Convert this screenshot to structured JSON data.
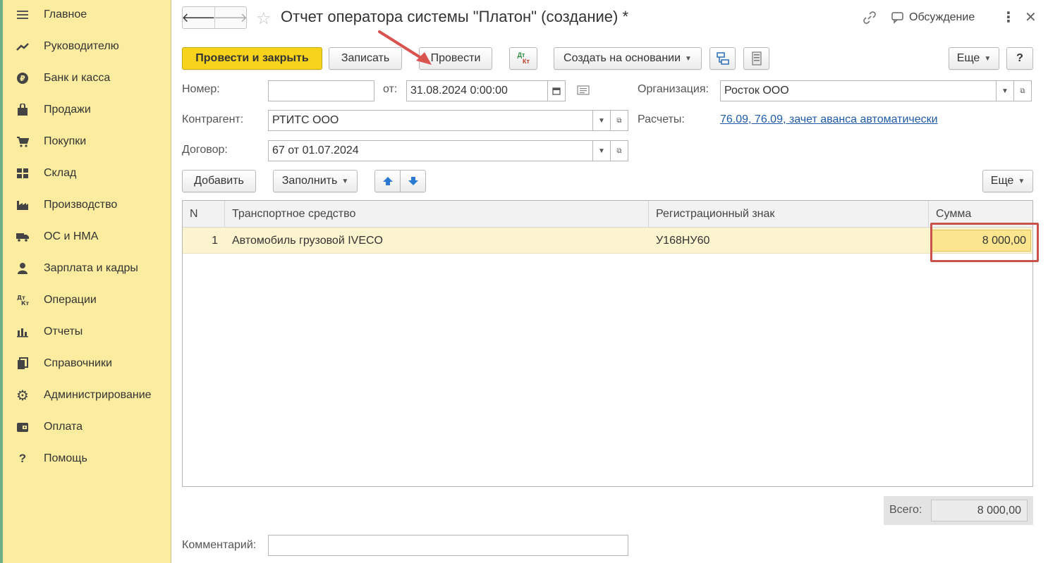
{
  "sidebar": {
    "items": [
      {
        "label": "Главное",
        "icon": "menu-icon"
      },
      {
        "label": "Руководителю",
        "icon": "trend-icon"
      },
      {
        "label": "Банк и касса",
        "icon": "ruble-icon"
      },
      {
        "label": "Продажи",
        "icon": "bag-icon"
      },
      {
        "label": "Покупки",
        "icon": "cart-icon"
      },
      {
        "label": "Склад",
        "icon": "warehouse-icon"
      },
      {
        "label": "Производство",
        "icon": "factory-icon"
      },
      {
        "label": "ОС и НМА",
        "icon": "truck-icon"
      },
      {
        "label": "Зарплата и кадры",
        "icon": "person-icon"
      },
      {
        "label": "Операции",
        "icon": "dt-kt-icon"
      },
      {
        "label": "Отчеты",
        "icon": "bar-chart-icon"
      },
      {
        "label": "Справочники",
        "icon": "books-icon"
      },
      {
        "label": "Администрирование",
        "icon": "gear-icon"
      },
      {
        "label": "Оплата",
        "icon": "wallet-icon"
      },
      {
        "label": "Помощь",
        "icon": "question-icon"
      }
    ]
  },
  "header": {
    "title": "Отчет оператора системы \"Платон\" (создание) *",
    "discussion_label": "Обсуждение"
  },
  "toolbar": {
    "post_close_label": "Провести и закрыть",
    "save_label": "Записать",
    "post_label": "Провести",
    "dtkt_top": "Дт",
    "dtkt_bottom": "Кт",
    "create_based_label": "Создать на основании",
    "more_label": "Еще",
    "help_label": "?"
  },
  "form": {
    "number_label": "Номер:",
    "number_value": "",
    "date_label": "от:",
    "date_value": "31.08.2024  0:00:00",
    "org_label": "Организация:",
    "org_value": "Росток ООО",
    "counterparty_label": "Контрагент:",
    "counterparty_value": "РТИТС ООО",
    "settlements_label": "Расчеты:",
    "settlements_link": "76.09, 76.09, зачет аванса автоматически",
    "contract_label": "Договор:",
    "contract_value": "67 от 01.07.2024"
  },
  "table_toolbar": {
    "add_label": "Добавить",
    "fill_label": "Заполнить",
    "more_label": "Еще"
  },
  "table": {
    "columns": [
      "N",
      "Транспортное средство",
      "Регистрационный знак",
      "Сумма"
    ],
    "rows": [
      {
        "n": "1",
        "vehicle": "Автомобиль грузовой IVECO",
        "reg": "У168НУ60",
        "sum": "8 000,00"
      }
    ]
  },
  "footer": {
    "total_label": "Всего:",
    "total_value": "8 000,00",
    "comment_label": "Комментарий:",
    "comment_value": ""
  },
  "colors": {
    "sidebar_bg": "#fbeca0",
    "primary_button": "#f7d41b",
    "selected_row": "#fcf3cf",
    "selected_cell": "#fbe58f",
    "annotation": "#c9534a",
    "link": "#1f5aa8"
  }
}
